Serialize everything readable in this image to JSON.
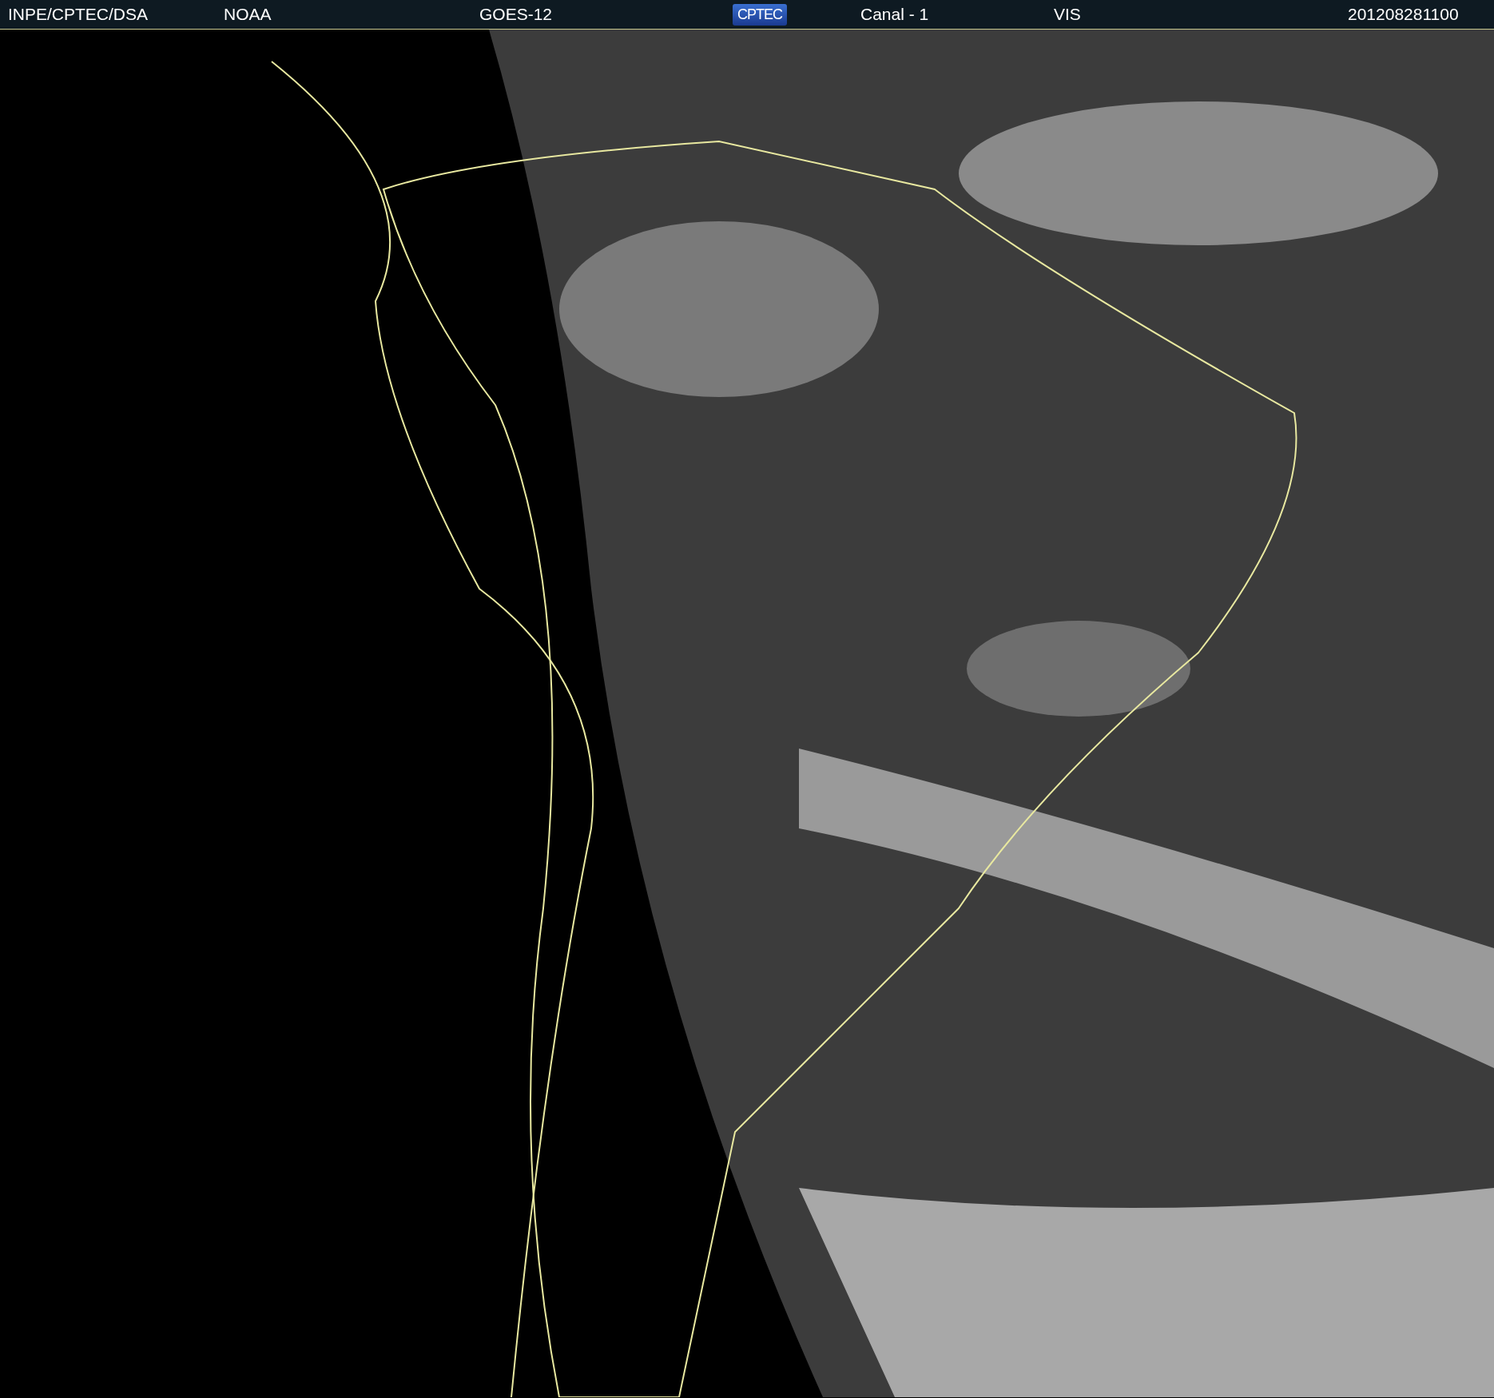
{
  "header": {
    "agency": "INPE/CPTEC/DSA",
    "source": "NOAA",
    "satellite": "GOES-12",
    "logo": "CPTEC",
    "channel": "Canal - 1",
    "band": "VIS",
    "timestamp": "201208281100"
  }
}
